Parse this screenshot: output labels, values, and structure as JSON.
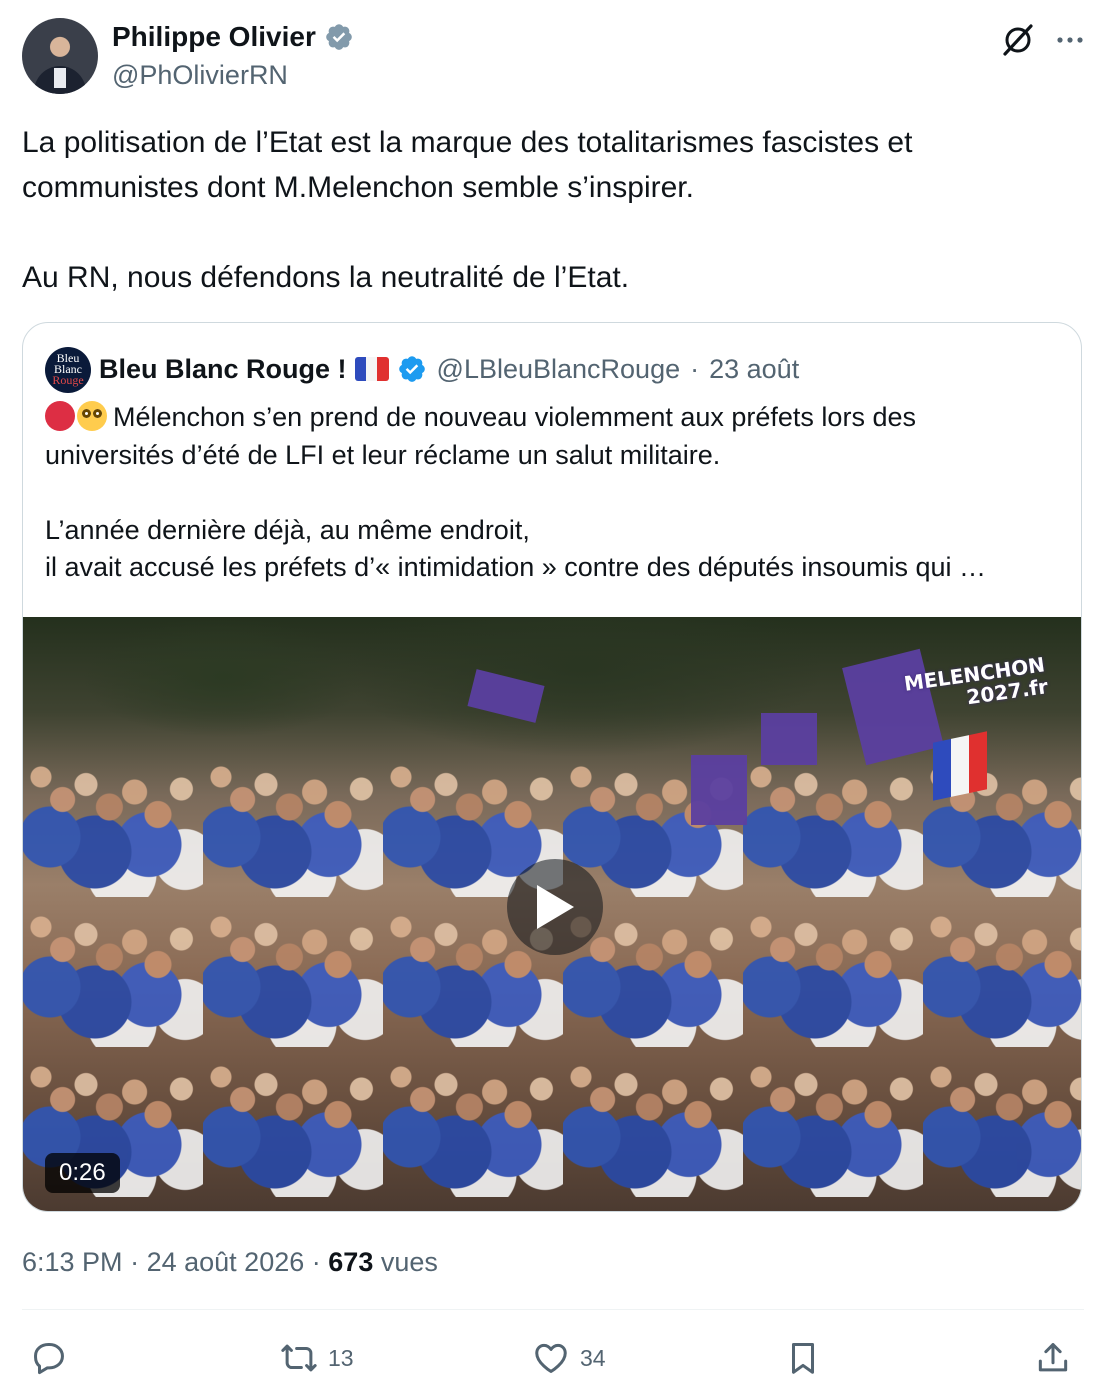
{
  "author": {
    "name": "Philippe Olivier",
    "handle": "@PhOlivierRN"
  },
  "post": {
    "text": "La politisation de l’Etat est la marque des totalitarismes fascistes et\ncommunistes dont M.Melenchon semble s’inspirer.\n\nAu RN, nous défendons la neutralité de l’Etat."
  },
  "quoted": {
    "name": "Bleu Blanc Rouge !",
    "handle": "@LBleuBlancRouge",
    "separator": "·",
    "date": "23 août",
    "avatar_text": [
      "Bleu",
      "Blanc",
      "Rouge"
    ],
    "text": "Mélenchon s’en prend de nouveau violemment aux préfets lors des\nuniversités d’été de LFI et leur réclame un salut militaire.\n\nL’année dernière déjà, au même endroit,\nil avait accusé les préfets d’« intimidation » contre des députés insoumis qui …",
    "video": {
      "duration": "0:26",
      "watermark_line1": "MELENCHON",
      "watermark_line2": "2027.fr"
    }
  },
  "meta": {
    "time": "6:13 PM",
    "separator1": "·",
    "date": "24 août 2026",
    "separator2": "·",
    "views": "673",
    "views_label": "vues"
  },
  "actions": {
    "reply_count": "",
    "repost_count": "13",
    "like_count": "34"
  },
  "colors": {
    "text": "#0f1419",
    "secondary": "#536471",
    "verified": "#1d9bf0",
    "border": "#cfd9de"
  }
}
